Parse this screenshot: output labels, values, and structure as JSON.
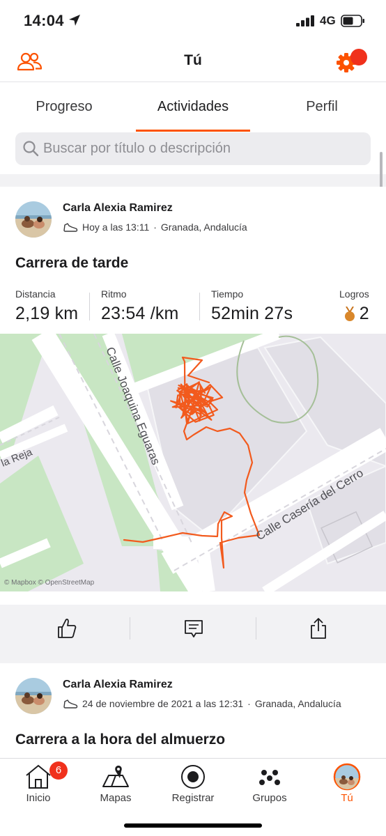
{
  "status_bar": {
    "time": "14:04",
    "network": "4G"
  },
  "header": {
    "title": "Tú"
  },
  "tabs": [
    {
      "label": "Progreso",
      "active": false
    },
    {
      "label": "Actividades",
      "active": true
    },
    {
      "label": "Perfil",
      "active": false
    }
  ],
  "search": {
    "placeholder": "Buscar por título o descripción",
    "value": ""
  },
  "activities": [
    {
      "athlete": "Carla Alexia Ramirez",
      "when": "Hoy a las 13:11",
      "location": "Granada, Andalucía",
      "separator": "·",
      "title": "Carrera de tarde",
      "stats": [
        {
          "label": "Distancia",
          "value": "2,19 km"
        },
        {
          "label": "Ritmo",
          "value": "23:54 /km"
        },
        {
          "label": "Tiempo",
          "value": "52min 27s"
        },
        {
          "label": "Logros",
          "value": "2"
        }
      ],
      "map": {
        "streets": [
          "Calle Joaquina Eguaras",
          "Calle Casería del Cerro",
          "la Reja"
        ],
        "credit": "© Mapbox © OpenStreetMap"
      }
    },
    {
      "athlete": "Carla Alexia Ramirez",
      "when": "24 de noviembre de 2021 a las 12:31",
      "location": "Granada, Andalucía",
      "separator": "·",
      "title": "Carrera a la hora del almuerzo"
    }
  ],
  "bottom_nav": [
    {
      "label": "Inicio",
      "icon": "home-icon",
      "badge": "6"
    },
    {
      "label": "Mapas",
      "icon": "map-icon"
    },
    {
      "label": "Registrar",
      "icon": "record-icon"
    },
    {
      "label": "Grupos",
      "icon": "groups-icon"
    },
    {
      "label": "Tú",
      "icon": "profile-avatar",
      "active": true
    }
  ],
  "colors": {
    "accent": "#fc5200",
    "route": "#f25a1d",
    "badge": "#f0311c",
    "park": "#c8e6c3",
    "map_bg": "#ebe9ef"
  }
}
